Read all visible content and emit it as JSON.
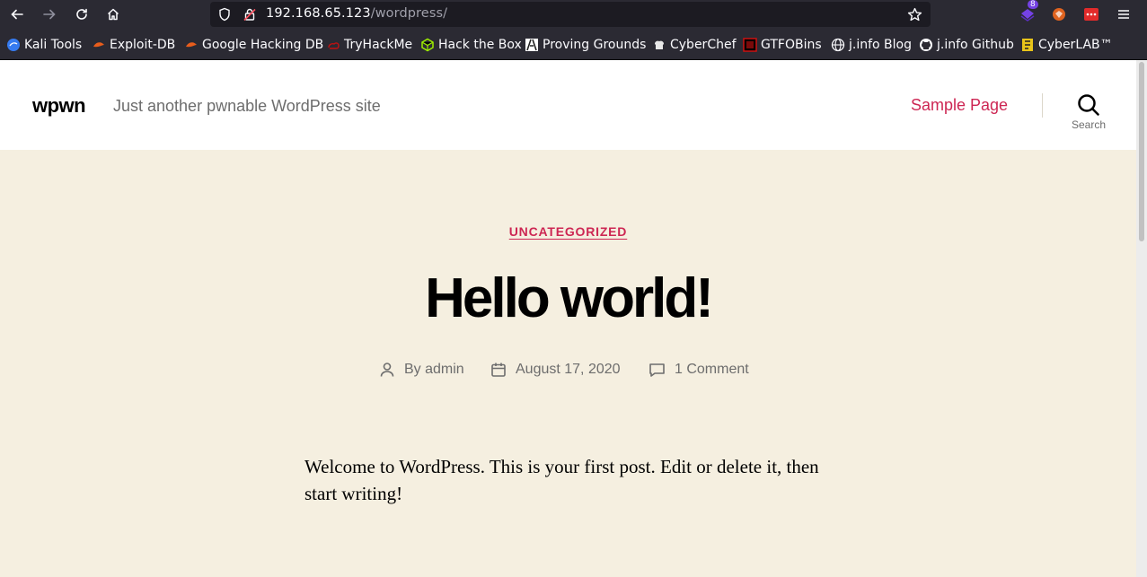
{
  "browser": {
    "url_host": "192.168.65.123",
    "url_path": "/wordpress/",
    "extension_badge": "8",
    "bookmarks": [
      {
        "label": "Kali Tools",
        "icon": "kali-icon"
      },
      {
        "label": "Exploit-DB",
        "icon": "exploit-db-icon"
      },
      {
        "label": "Google Hacking DB",
        "icon": "ghdb-icon"
      },
      {
        "label": "TryHackMe",
        "icon": "tryhackme-icon"
      },
      {
        "label": "Hack the Box",
        "icon": "hackthebox-icon"
      },
      {
        "label": "Proving Grounds",
        "icon": "proving-grounds-icon"
      },
      {
        "label": "CyberChef",
        "icon": "cyberchef-icon"
      },
      {
        "label": "GTFOBins",
        "icon": "gtfobins-icon"
      },
      {
        "label": "j.info Blog",
        "icon": "globe-icon"
      },
      {
        "label": "j.info Github",
        "icon": "github-icon"
      },
      {
        "label": "CyberLAB™",
        "icon": "cyberlab-icon"
      }
    ]
  },
  "site": {
    "title": "wpwn",
    "description": "Just another pwnable WordPress site",
    "menu_item": "Sample Page",
    "search_label": "Search"
  },
  "post": {
    "category": "UNCATEGORIZED",
    "title": "Hello world!",
    "author": "By admin",
    "date": "August 17, 2020",
    "comments": "1 Comment",
    "content": "Welcome to WordPress. This is your first post. Edit or delete it, then start writing!"
  },
  "colors": {
    "accent": "#cd2653",
    "background": "#f5efe0",
    "browser_chrome": "#2b2a33"
  }
}
